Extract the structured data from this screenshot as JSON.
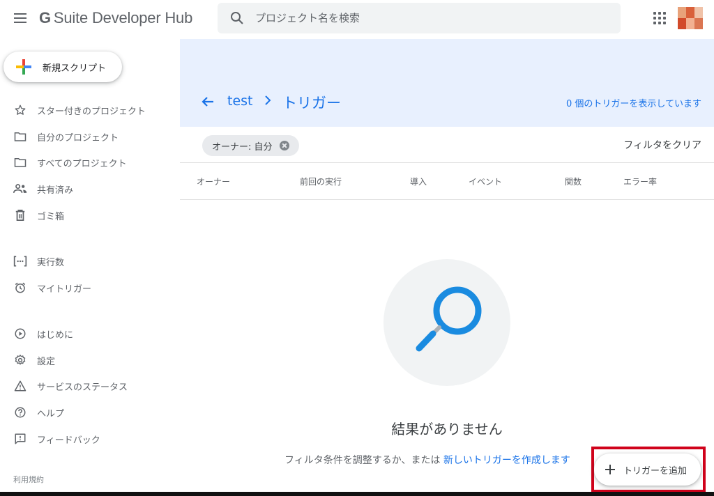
{
  "header": {
    "logo_letter": "G",
    "app_title": "Suite Developer Hub",
    "search_placeholder": "プロジェクト名を検索",
    "menu_icon": "hamburger-menu-icon",
    "apps_icon": "apps-grid-icon"
  },
  "sidebar": {
    "new_script_label": "新規スクリプト",
    "items": [
      {
        "label": "スター付きのプロジェクト",
        "icon": "star-icon"
      },
      {
        "label": "自分のプロジェクト",
        "icon": "folder-icon"
      },
      {
        "label": "すべてのプロジェクト",
        "icon": "folder-icon"
      },
      {
        "label": "共有済み",
        "icon": "people-icon"
      },
      {
        "label": "ゴミ箱",
        "icon": "trash-icon"
      },
      {
        "label": "実行数",
        "icon": "executions-icon"
      },
      {
        "label": "マイトリガー",
        "icon": "alarm-icon"
      },
      {
        "label": "はじめに",
        "icon": "play-circle-icon"
      },
      {
        "label": "設定",
        "icon": "gear-icon"
      },
      {
        "label": "サービスのステータス",
        "icon": "warning-icon"
      },
      {
        "label": "ヘルプ",
        "icon": "help-icon"
      },
      {
        "label": "フィードバック",
        "icon": "feedback-icon"
      }
    ],
    "terms_label": "利用規約"
  },
  "main": {
    "breadcrumb_project": "test",
    "breadcrumb_current": "トリガー",
    "trigger_count_text": "0 個のトリガーを表示しています",
    "filter_chip": "オーナー: 自分",
    "clear_filter": "フィルタをクリア",
    "columns": [
      "オーナー",
      "前回の実行",
      "導入",
      "イベント",
      "関数",
      "エラー率"
    ],
    "empty_title": "結果がありません",
    "empty_sub_prefix": "フィルタ条件を調整するか、または ",
    "empty_sub_link": "新しいトリガーを作成します",
    "add_trigger_label": "トリガーを追加"
  },
  "colors": {
    "accent": "#1a73e8",
    "header_band": "#e8f0fe",
    "highlight_box": "#d0021b"
  }
}
